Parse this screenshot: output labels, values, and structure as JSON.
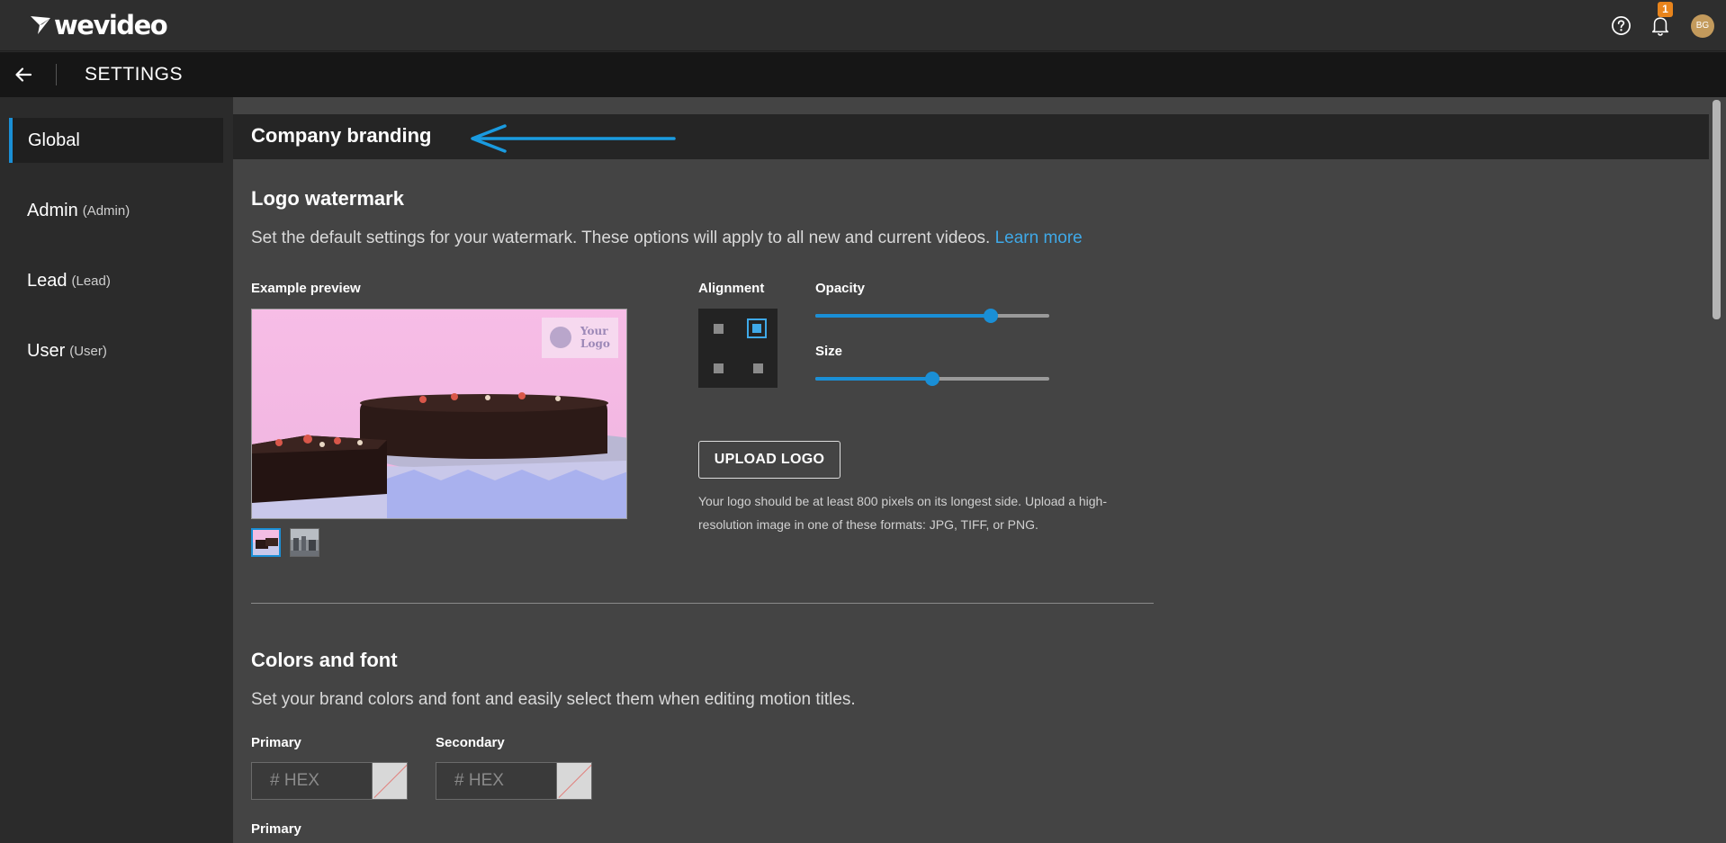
{
  "header": {
    "logo_text": "wevideo",
    "notification_count": "1",
    "avatar_initials": "BG"
  },
  "settings_bar": {
    "title": "SETTINGS"
  },
  "sidebar": {
    "items": [
      {
        "name": "Global",
        "role": ""
      },
      {
        "name": "Admin",
        "role": "(Admin)"
      },
      {
        "name": "Lead",
        "role": "(Lead)"
      },
      {
        "name": "User",
        "role": "(User)"
      }
    ],
    "active_index": 0
  },
  "company_branding": {
    "title": "Company branding"
  },
  "logo_watermark": {
    "title": "Logo watermark",
    "description": "Set the default settings for your watermark. These options will apply to all new and current videos.",
    "learn_more": "Learn more",
    "example_preview_label": "Example preview",
    "preview_logo_text": [
      "Your",
      "Logo"
    ],
    "alignment_label": "Alignment",
    "alignment_selected": "top-right",
    "opacity_label": "Opacity",
    "opacity_value": 0.75,
    "size_label": "Size",
    "size_value": 0.5,
    "upload_button": "UPLOAD LOGO",
    "upload_help": "Your logo should be at least 800 pixels on its longest side. Upload a high-resolution image in one of these formats: JPG, TIFF, or PNG."
  },
  "colors_and_font": {
    "title": "Colors and font",
    "description": "Set your brand colors and font and easily select them when editing motion titles.",
    "primary_label": "Primary",
    "secondary_label": "Secondary",
    "hex_placeholder": "# HEX",
    "primary_font_label": "Primary"
  },
  "colors": {
    "accent": "#1a8fd6",
    "link": "#3fa9e8",
    "badge": "#e8841c"
  }
}
